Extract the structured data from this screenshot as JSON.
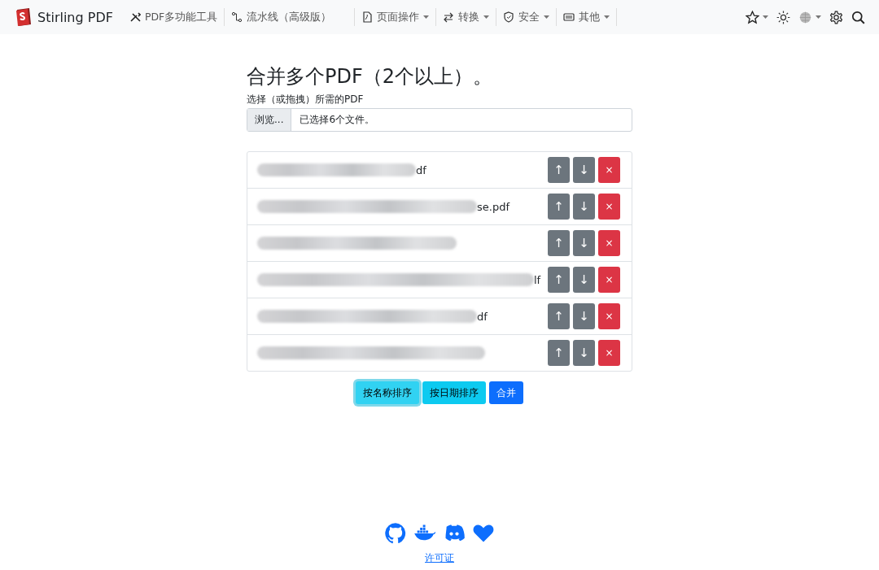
{
  "navbar": {
    "brand": "Stirling PDF",
    "items": [
      {
        "label": "PDF多功能工具",
        "dropdown": false
      },
      {
        "label": "流水线（高级版）",
        "dropdown": false
      },
      {
        "label": "页面操作",
        "dropdown": true
      },
      {
        "label": "转换",
        "dropdown": true
      },
      {
        "label": "安全",
        "dropdown": true
      },
      {
        "label": "其他",
        "dropdown": true
      }
    ]
  },
  "title": "合并多个PDF（2个以上）。",
  "file_input": {
    "label": "选择（或拖拽）所需的PDF",
    "button": "浏览...",
    "value": "已选择6个文件。"
  },
  "files": [
    {
      "redacted": true,
      "visible_end": "df"
    },
    {
      "redacted": true,
      "visible_end": "se.pdf"
    },
    {
      "redacted": true
    },
    {
      "redacted": true,
      "visible_end": "lf"
    },
    {
      "redacted": true,
      "visible_end": "df"
    },
    {
      "redacted": true
    }
  ],
  "row_buttons": {
    "up": "↑",
    "down": "↓",
    "remove": "×"
  },
  "buttons": [
    {
      "kind": "info",
      "label": "按名称排序",
      "focused": true
    },
    {
      "kind": "info",
      "label": "按日期排序",
      "focused": false
    },
    {
      "kind": "primary",
      "label": "合并",
      "focused": false
    }
  ],
  "footer": {
    "link": "许可证"
  }
}
